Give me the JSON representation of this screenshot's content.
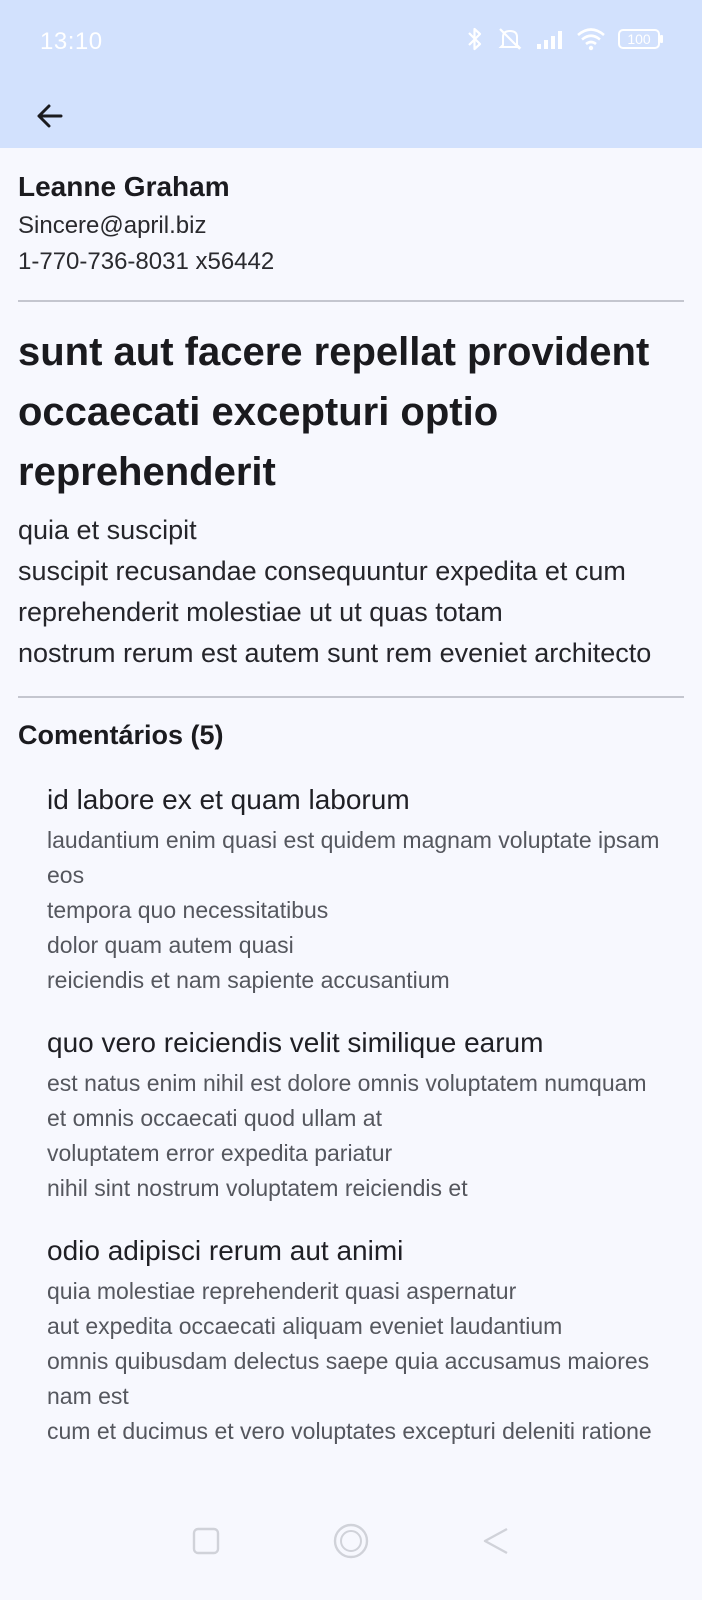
{
  "status_bar": {
    "time": "13:10",
    "battery": "100",
    "icons": [
      "bluetooth-icon",
      "mute-icon",
      "signal-icon",
      "wifi-icon",
      "battery-icon"
    ]
  },
  "app_bar": {
    "back_icon": "arrow-left-icon"
  },
  "author": {
    "name": "Leanne Graham",
    "email": "Sincere@april.biz",
    "phone": "1-770-736-8031 x56442"
  },
  "post": {
    "title": "sunt aut facere repellat provident occaecati excepturi optio reprehenderit",
    "body": "quia et suscipit\nsuscipit recusandae consequuntur expedita et cum reprehenderit molestiae ut ut quas totam\nnostrum rerum est autem sunt rem eveniet architecto"
  },
  "comments": {
    "heading": "Comentários (5)",
    "items": [
      {
        "title": "id labore ex et quam laborum",
        "body": "laudantium enim quasi est quidem magnam voluptate ipsam eos\ntempora quo necessitatibus\ndolor quam autem quasi\nreiciendis et nam sapiente accusantium"
      },
      {
        "title": "quo vero reiciendis velit similique earum",
        "body": "est natus enim nihil est dolore omnis voluptatem numquam\net omnis occaecati quod ullam at\nvoluptatem error expedita pariatur\nnihil sint nostrum voluptatem reiciendis et"
      },
      {
        "title": "odio adipisci rerum aut animi",
        "body": "quia molestiae reprehenderit quasi aspernatur\naut expedita occaecati aliquam eveniet laudantium\nomnis quibusdam delectus saepe quia accusamus maiores nam est\ncum et ducimus et vero voluptates excepturi deleniti ratione"
      }
    ]
  },
  "nav_bar": {
    "icons": [
      "recents-square-icon",
      "home-circle-icon",
      "back-triangle-icon"
    ]
  },
  "colors": {
    "app_bar_bg": "#d2e1fd",
    "page_bg": "#f7f8fe",
    "divider": "#c4c6cf"
  }
}
